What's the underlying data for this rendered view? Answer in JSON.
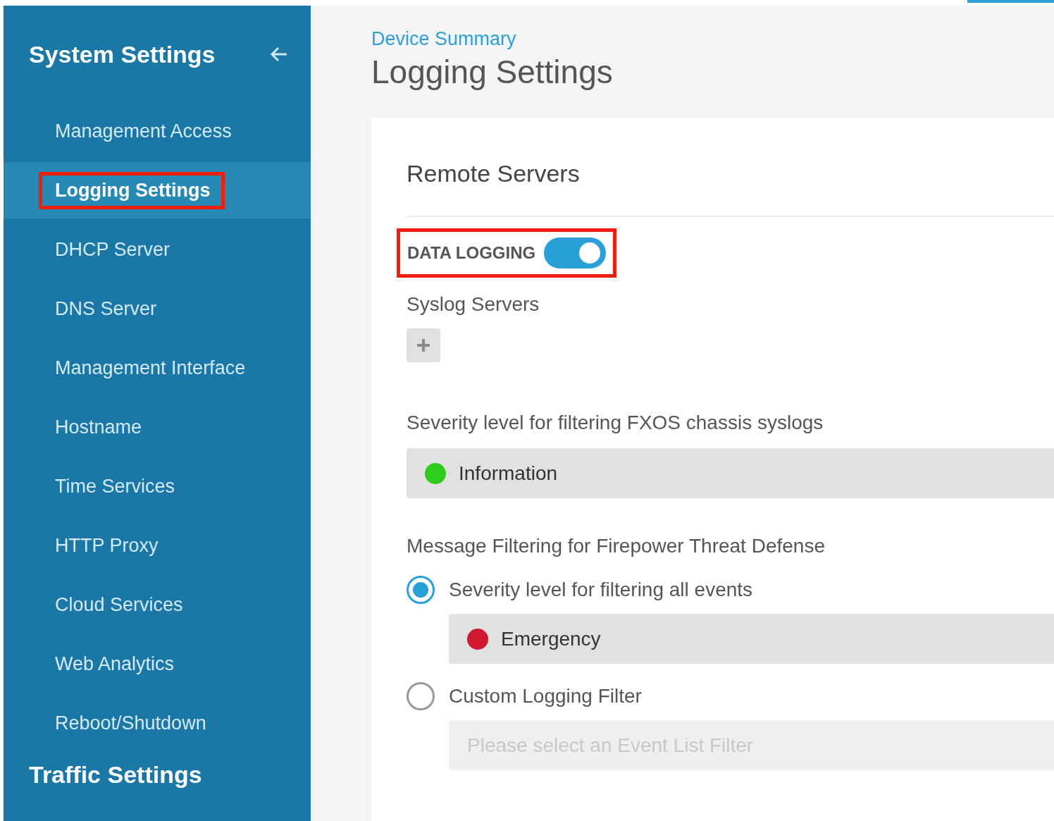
{
  "sidebar": {
    "title": "System Settings",
    "items": [
      {
        "label": "Management Access",
        "selected": false,
        "highlighted": false
      },
      {
        "label": "Logging Settings",
        "selected": true,
        "highlighted": true
      },
      {
        "label": "DHCP Server",
        "selected": false,
        "highlighted": false
      },
      {
        "label": "DNS Server",
        "selected": false,
        "highlighted": false
      },
      {
        "label": "Management Interface",
        "selected": false,
        "highlighted": false
      },
      {
        "label": "Hostname",
        "selected": false,
        "highlighted": false
      },
      {
        "label": "Time Services",
        "selected": false,
        "highlighted": false
      },
      {
        "label": "HTTP Proxy",
        "selected": false,
        "highlighted": false
      },
      {
        "label": "Cloud Services",
        "selected": false,
        "highlighted": false
      },
      {
        "label": "Web Analytics",
        "selected": false,
        "highlighted": false
      },
      {
        "label": "Reboot/Shutdown",
        "selected": false,
        "highlighted": false
      }
    ],
    "section_title": "Traffic Settings"
  },
  "breadcrumb": "Device Summary",
  "page_title": "Logging Settings",
  "card": {
    "title": "Remote Servers",
    "data_logging": {
      "label": "DATA LOGGING",
      "on": true,
      "highlighted": true
    },
    "syslog_label": "Syslog Servers",
    "fxos_label": "Severity level for filtering FXOS chassis syslogs",
    "fxos_select": {
      "value": "Information",
      "color": "#2ecc1a"
    },
    "message_label": "Message Filtering for Firepower Threat Defense",
    "options": [
      {
        "label": "Severity level for filtering all events",
        "selected": true,
        "select": {
          "value": "Emergency",
          "color": "#d0192e"
        }
      },
      {
        "label": "Custom Logging Filter",
        "selected": false,
        "select": {
          "placeholder": "Please select an Event List Filter"
        }
      }
    ]
  }
}
